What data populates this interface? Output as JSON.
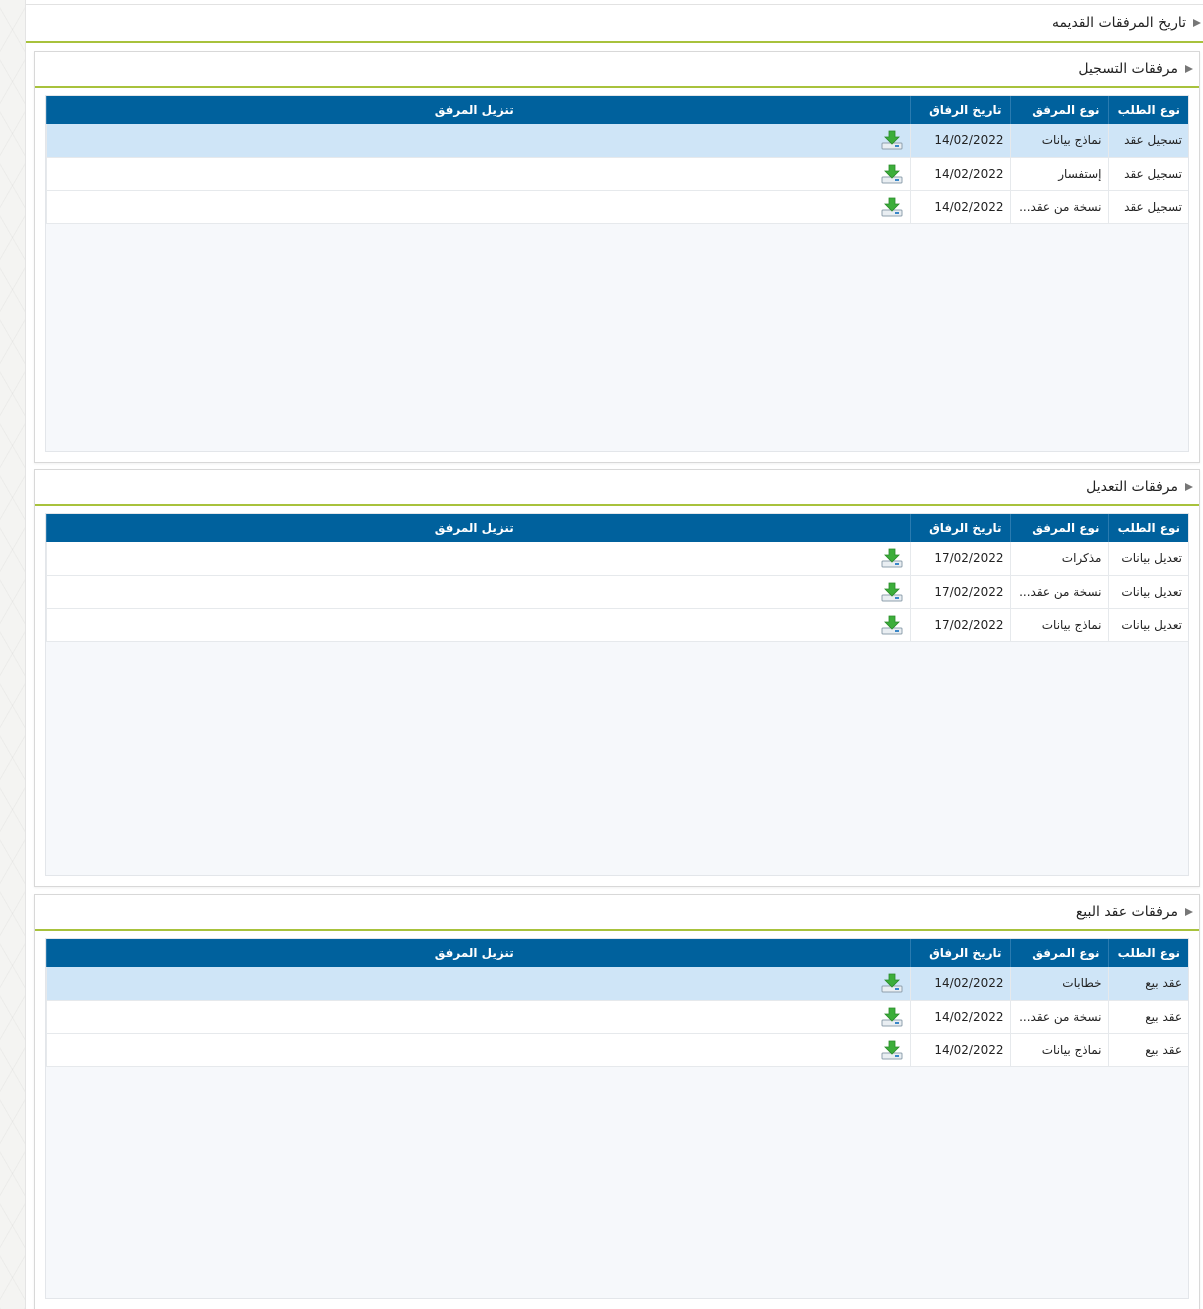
{
  "page": {
    "title": "تاريخ المرفقات القديمه"
  },
  "columns": {
    "request_type": "نوع الطلب",
    "attachment_type": "نوع المرفق",
    "attachment_date": "تاريخ الرفاق",
    "download": "تنزيل المرفق"
  },
  "sections": [
    {
      "title": "مرفقات التسجيل",
      "rows": [
        {
          "request_type": "تسجيل عقد",
          "attachment_type": "نماذج بيانات",
          "date": "14/02/2022",
          "selected": true
        },
        {
          "request_type": "تسجيل عقد",
          "attachment_type": "إستفسار",
          "date": "14/02/2022",
          "selected": false
        },
        {
          "request_type": "تسجيل عقد",
          "attachment_type": "نسخة من عقد...",
          "date": "14/02/2022",
          "selected": false
        }
      ]
    },
    {
      "title": "مرفقات التعديل",
      "rows": [
        {
          "request_type": "تعديل بيانات",
          "attachment_type": "مذكرات",
          "date": "17/02/2022",
          "selected": false
        },
        {
          "request_type": "تعديل بيانات",
          "attachment_type": "نسخة من عقد...",
          "date": "17/02/2022",
          "selected": false
        },
        {
          "request_type": "تعديل بيانات",
          "attachment_type": "نماذج بيانات",
          "date": "17/02/2022",
          "selected": false
        }
      ]
    },
    {
      "title": "مرفقات عقد البيع",
      "rows": [
        {
          "request_type": "عقد بيع",
          "attachment_type": "خطابات",
          "date": "14/02/2022",
          "selected": true
        },
        {
          "request_type": "عقد بيع",
          "attachment_type": "نسخة من عقد...",
          "date": "14/02/2022",
          "selected": false
        },
        {
          "request_type": "عقد بيع",
          "attachment_type": "نماذج بيانات",
          "date": "14/02/2022",
          "selected": false
        }
      ]
    }
  ],
  "icons": {
    "section_toggle": "triangle-right-icon",
    "download": "download-tray-icon"
  },
  "colors": {
    "header_bg": "#00619d",
    "accent_line": "#a8c23c",
    "selected_row": "#cfe5f7",
    "download_arrow": "#3cae3a"
  }
}
